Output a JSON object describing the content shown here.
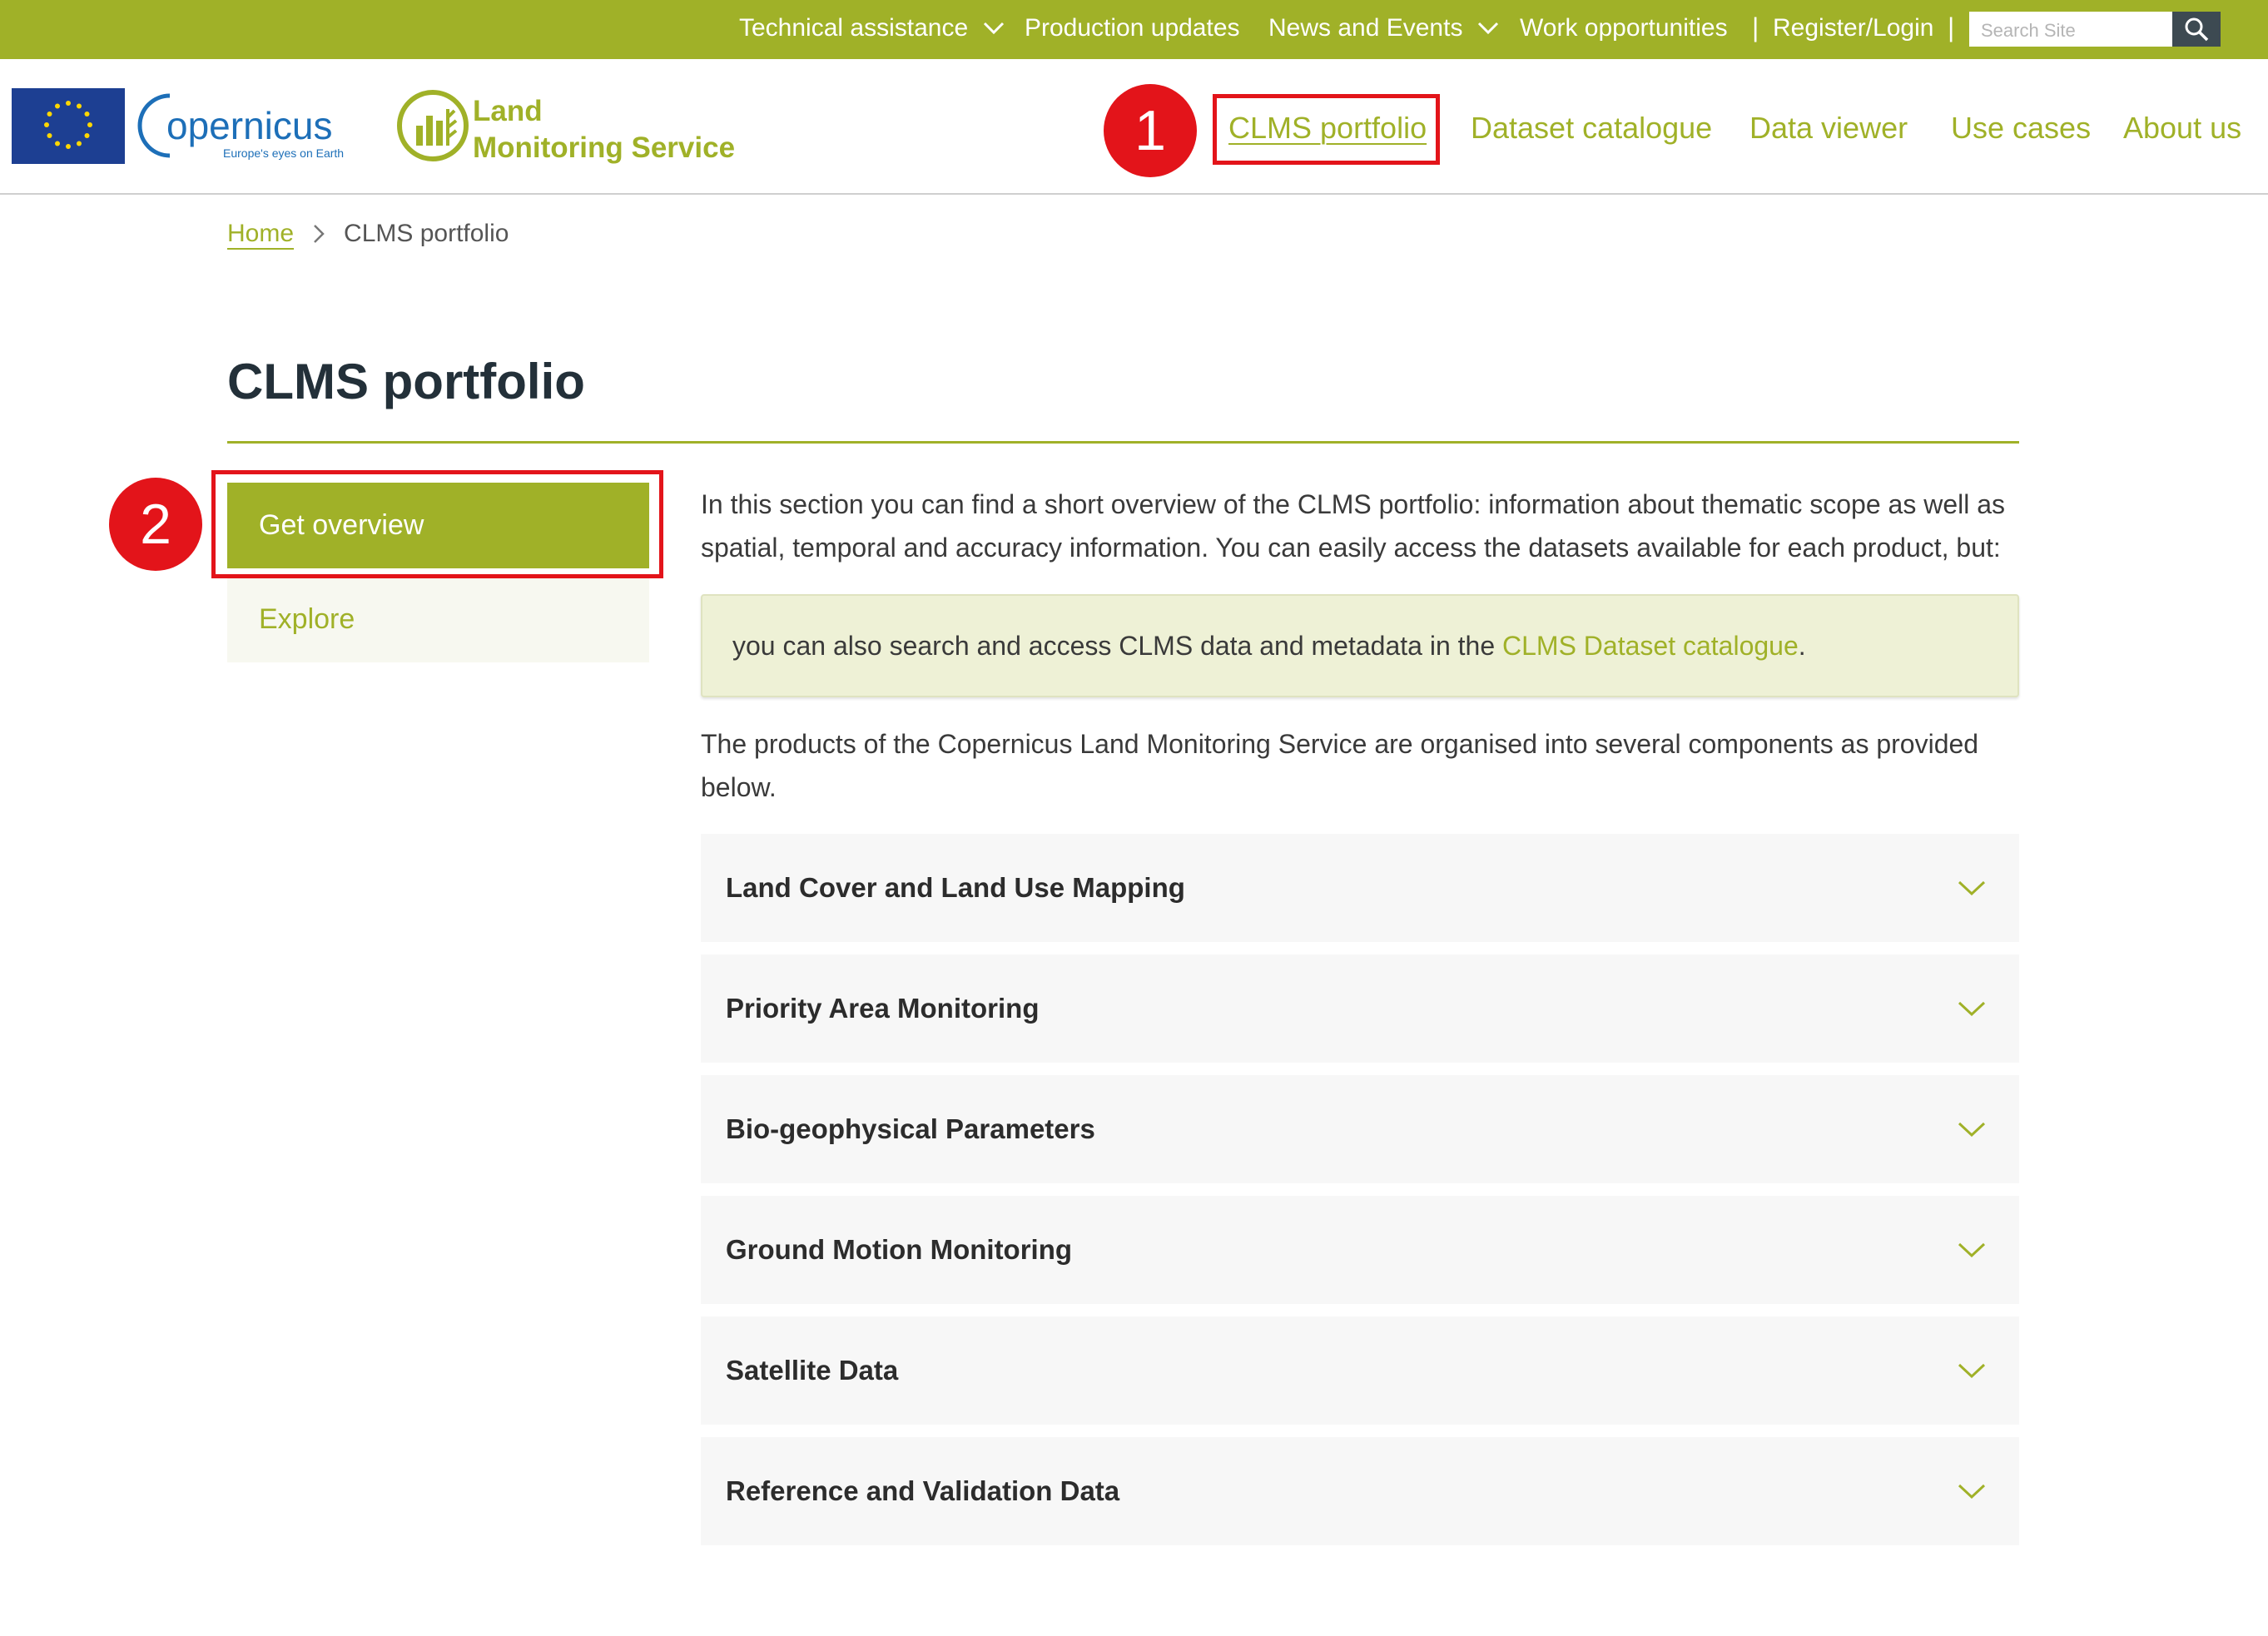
{
  "topbar": {
    "items": [
      {
        "label": "Technical assistance",
        "dropdown": true
      },
      {
        "label": "Production updates",
        "dropdown": false
      },
      {
        "label": "News and Events",
        "dropdown": true
      },
      {
        "label": "Work opportunities",
        "dropdown": false
      },
      {
        "label": "Register/Login",
        "dropdown": false
      }
    ],
    "separator": "|",
    "search": {
      "placeholder": "Search Site",
      "icon": "search-icon"
    }
  },
  "header": {
    "logos": {
      "eu": "eu-flag",
      "copernicus_word": "opernicus",
      "copernicus_tagline": "Europe's eyes on Earth",
      "service_line1": "Land",
      "service_line2": "Monitoring Service"
    },
    "main_nav": [
      "CLMS portfolio",
      "Dataset catalogue",
      "Data viewer",
      "Use cases",
      "About us"
    ]
  },
  "annotations": {
    "step1": "1",
    "step2": "2",
    "highlight_color": "#e3141a"
  },
  "breadcrumb": {
    "home": "Home",
    "current": "CLMS portfolio"
  },
  "page": {
    "title": "CLMS portfolio",
    "left_menu": [
      "Get overview",
      "Explore"
    ],
    "intro": "In this section you can find a short overview of the CLMS portfolio: information about thematic scope as well as spatial, temporal and accuracy information. You can easily access the datasets available for each product, but:",
    "note_text": "you can also search and access CLMS data and metadata in the ",
    "note_link": "CLMS Dataset catalogue",
    "note_end": ".",
    "components_text": "The products of the Copernicus Land Monitoring Service are organised into several components as provided below.",
    "accordion": [
      "Land Cover and Land Use Mapping",
      "Priority Area Monitoring",
      "Bio-geophysical Parameters",
      "Ground Motion Monitoring",
      "Satellite Data",
      "Reference and Validation Data"
    ]
  },
  "colors": {
    "brand_green": "#a0b128",
    "dark_text": "#233039",
    "note_bg": "#eef1d6"
  }
}
